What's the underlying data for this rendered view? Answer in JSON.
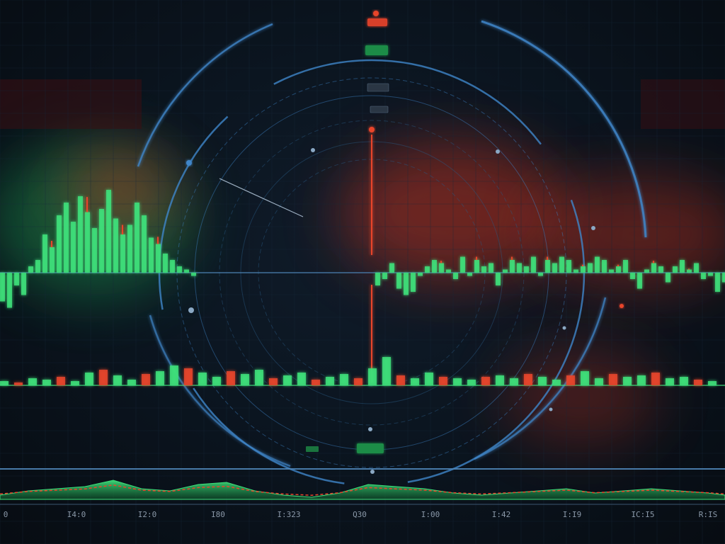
{
  "colors": {
    "background": "#0a1018",
    "grid": "#16283a",
    "ring": "#3f86c9",
    "ring_faint": "#2a5a86",
    "axis_line": "#4f86b8",
    "up": "#3ee07a",
    "down": "#e8452c",
    "glow_red": "#c8321e",
    "glow_green": "#1fa455",
    "tag_red": "#d8402a",
    "tag_green": "#1e8c46",
    "tag_dark": "#2a3644"
  },
  "chart_data": [
    {
      "type": "bar",
      "panel": "main-waveform",
      "x": [
        0,
        10,
        20,
        30,
        40,
        50,
        60,
        70,
        80,
        90,
        100,
        110,
        120,
        130,
        140,
        150,
        160,
        170,
        180,
        190,
        200,
        210,
        220,
        230,
        240,
        250,
        260,
        270,
        530,
        540,
        550,
        560,
        570,
        580,
        590,
        600,
        610,
        620,
        630,
        640,
        650,
        660,
        670,
        680,
        690,
        700,
        710,
        720,
        730,
        740,
        750,
        760,
        770,
        780,
        790,
        800,
        810,
        820,
        830,
        840,
        850,
        860,
        870,
        880,
        890,
        900,
        910,
        920,
        930,
        940,
        950,
        960,
        970,
        980,
        990,
        1000,
        1010,
        1020
      ],
      "values": [
        -45,
        -55,
        -20,
        -35,
        10,
        20,
        60,
        40,
        90,
        110,
        80,
        120,
        95,
        70,
        100,
        130,
        85,
        60,
        75,
        110,
        90,
        55,
        45,
        30,
        20,
        10,
        5,
        -5,
        -20,
        -10,
        15,
        -25,
        -35,
        -30,
        -5,
        10,
        20,
        15,
        5,
        -10,
        25,
        -5,
        20,
        10,
        15,
        -20,
        5,
        20,
        15,
        10,
        25,
        -5,
        20,
        15,
        25,
        20,
        5,
        10,
        15,
        25,
        20,
        5,
        10,
        20,
        -10,
        -25,
        5,
        15,
        10,
        -15,
        10,
        20,
        5,
        15,
        -10,
        -5,
        -30,
        -15
      ],
      "ylim": [
        -150,
        150
      ]
    },
    {
      "type": "bar",
      "panel": "mid-volume",
      "x": [
        0,
        20,
        40,
        60,
        80,
        100,
        120,
        140,
        160,
        180,
        200,
        220,
        240,
        260,
        280,
        300,
        320,
        340,
        360,
        380,
        400,
        420,
        440,
        460,
        480,
        500,
        520,
        540,
        560,
        580,
        600,
        620,
        640,
        660,
        680,
        700,
        720,
        740,
        760,
        780,
        800,
        820,
        840,
        860,
        880,
        900,
        920,
        940,
        960,
        980,
        1000
      ],
      "values": [
        6,
        4,
        10,
        8,
        12,
        6,
        18,
        22,
        14,
        8,
        16,
        20,
        28,
        24,
        18,
        12,
        20,
        16,
        22,
        10,
        14,
        18,
        8,
        12,
        16,
        10,
        24,
        40,
        14,
        10,
        18,
        12,
        10,
        8,
        12,
        14,
        10,
        16,
        12,
        8,
        14,
        20,
        10,
        16,
        12,
        14,
        18,
        10,
        12,
        8,
        6
      ],
      "ylim": [
        0,
        50
      ]
    },
    {
      "type": "area",
      "panel": "bottom-timeline",
      "x": [
        0,
        40,
        80,
        120,
        160,
        200,
        240,
        280,
        320,
        360,
        400,
        440,
        480,
        520,
        560,
        600,
        640,
        680,
        720,
        760,
        800,
        840,
        880,
        920,
        960,
        1000,
        1024
      ],
      "values": [
        4,
        8,
        10,
        12,
        18,
        10,
        8,
        14,
        16,
        8,
        4,
        2,
        6,
        14,
        12,
        10,
        6,
        4,
        6,
        8,
        10,
        6,
        8,
        10,
        8,
        6,
        4
      ],
      "ylim": [
        0,
        30
      ],
      "x_tick_labels": [
        "0",
        "I4:0",
        "I2:0",
        "I80",
        "I:323",
        "Q30",
        "I:00",
        "I:42",
        "I:I9",
        "IC:I5",
        "R:IS"
      ]
    }
  ],
  "ui_tags": [
    {
      "name": "top-red-tag",
      "text": "",
      "color": "red"
    },
    {
      "name": "top-green-tag",
      "text": "",
      "color": "green"
    },
    {
      "name": "dark-tag-1",
      "text": "",
      "color": "dark"
    },
    {
      "name": "dark-tag-2",
      "text": "",
      "color": "dark"
    },
    {
      "name": "bottom-green-tag",
      "text": "",
      "color": "green"
    }
  ]
}
